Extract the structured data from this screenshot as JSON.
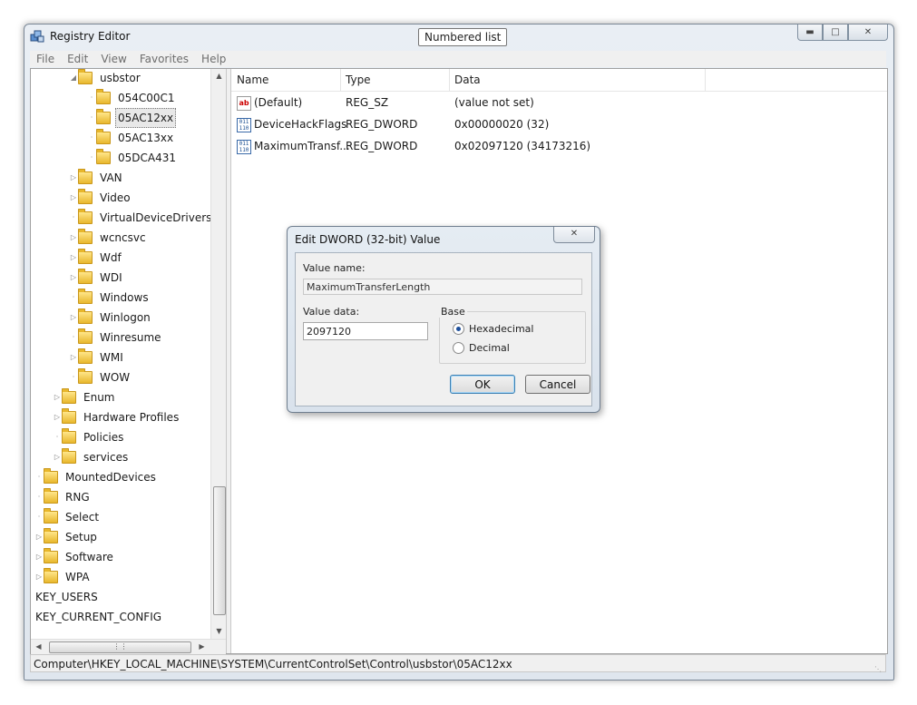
{
  "window": {
    "title": "Registry Editor",
    "tooltip": "Numbered list",
    "caption_buttons": [
      "minimize-icon",
      "maximize-icon",
      "close-icon"
    ]
  },
  "menu": [
    "File",
    "Edit",
    "View",
    "Favorites",
    "Help"
  ],
  "tree": {
    "items": [
      {
        "label": "usbstor",
        "expander": "open"
      },
      {
        "label": "054C00C1",
        "expander": "none"
      },
      {
        "label": "05AC12xx",
        "expander": "none",
        "selected": true
      },
      {
        "label": "05AC13xx",
        "expander": "none"
      },
      {
        "label": "05DCA431",
        "expander": "none"
      },
      {
        "label": "VAN",
        "expander": "closed"
      },
      {
        "label": "Video",
        "expander": "closed"
      },
      {
        "label": "VirtualDeviceDrivers",
        "expander": "none"
      },
      {
        "label": "wcncsvc",
        "expander": "closed"
      },
      {
        "label": "Wdf",
        "expander": "closed"
      },
      {
        "label": "WDI",
        "expander": "closed"
      },
      {
        "label": "Windows",
        "expander": "none"
      },
      {
        "label": "Winlogon",
        "expander": "closed"
      },
      {
        "label": "Winresume",
        "expander": "none"
      },
      {
        "label": "WMI",
        "expander": "closed"
      },
      {
        "label": "WOW",
        "expander": "none"
      },
      {
        "label": "Enum",
        "expander": "closed"
      },
      {
        "label": "Hardware Profiles",
        "expander": "closed"
      },
      {
        "label": "Policies",
        "expander": "none"
      },
      {
        "label": "services",
        "expander": "closed"
      },
      {
        "label": "MountedDevices",
        "expander": "none"
      },
      {
        "label": "RNG",
        "expander": "none"
      },
      {
        "label": "Select",
        "expander": "none"
      },
      {
        "label": "Setup",
        "expander": "closed"
      },
      {
        "label": "Software",
        "expander": "closed"
      },
      {
        "label": "WPA",
        "expander": "closed"
      },
      {
        "label": "KEY_USERS",
        "expander": "none"
      },
      {
        "label": "KEY_CURRENT_CONFIG",
        "expander": "none"
      }
    ]
  },
  "list": {
    "columns": [
      "Name",
      "Type",
      "Data"
    ],
    "rows": [
      {
        "icon": "string-value-icon",
        "name": "(Default)",
        "type": "REG_SZ",
        "data": "(value not set)"
      },
      {
        "icon": "binary-value-icon",
        "name": "DeviceHackFlags",
        "type": "REG_DWORD",
        "data": "0x00000020 (32)"
      },
      {
        "icon": "binary-value-icon",
        "name": "MaximumTransf...",
        "type": "REG_DWORD",
        "data": "0x02097120 (34173216)"
      }
    ]
  },
  "dialog": {
    "title": "Edit DWORD (32-bit) Value",
    "value_name_label": "Value name:",
    "value_name": "MaximumTransferLength",
    "value_data_label": "Value data:",
    "value_data": "2097120",
    "base_label": "Base",
    "hex_label": "Hexadecimal",
    "dec_label": "Decimal",
    "base_selected": "Hexadecimal",
    "ok_label": "OK",
    "cancel_label": "Cancel"
  },
  "statusbar": {
    "path": "Computer\\HKEY_LOCAL_MACHINE\\SYSTEM\\CurrentControlSet\\Control\\usbstor\\05AC12xx"
  }
}
